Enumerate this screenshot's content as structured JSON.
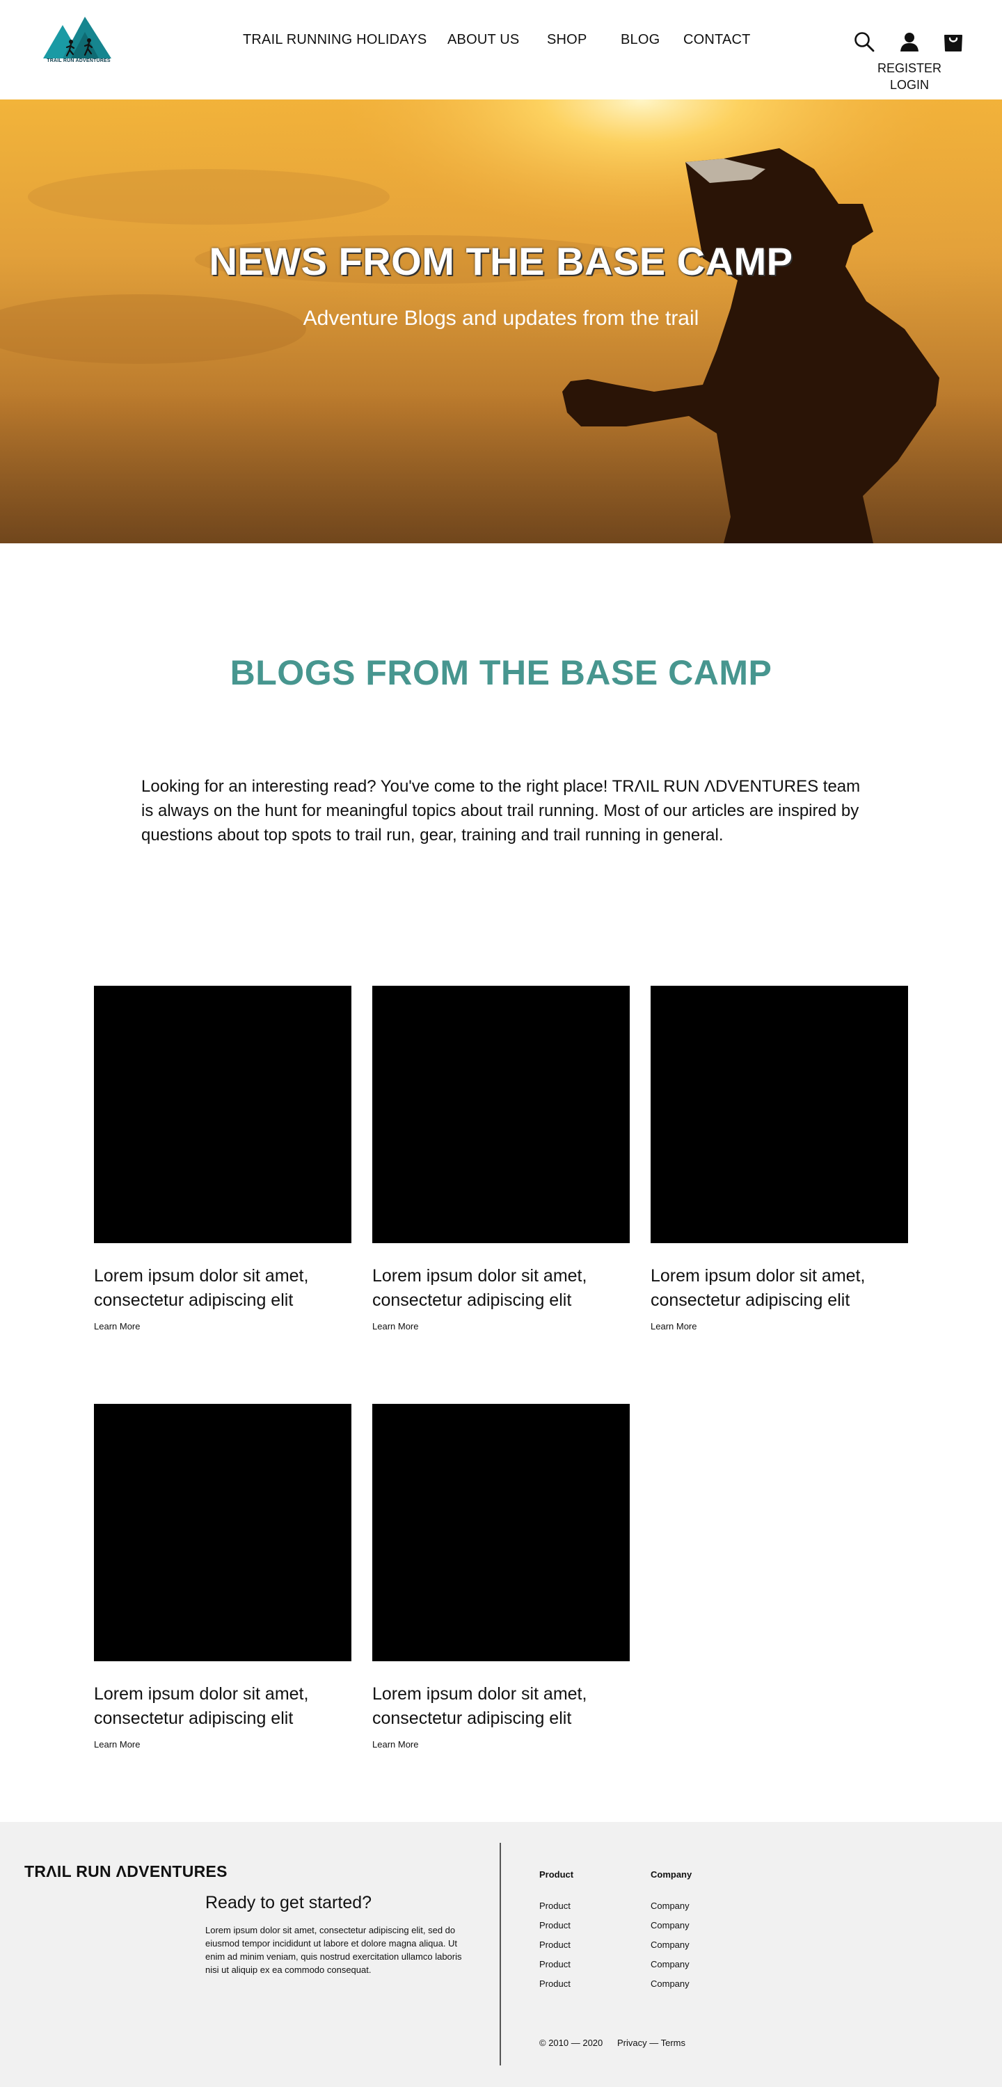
{
  "header": {
    "logo_text": "TRAIL RUN ADVENTURES",
    "nav": [
      {
        "label": "TRAIL RUNNING HOLIDAYS"
      },
      {
        "label": "ABOUT US"
      },
      {
        "label": "SHOP"
      },
      {
        "label": "BLOG"
      },
      {
        "label": "CONTACT"
      }
    ],
    "icons": [
      "search-icon",
      "user-icon",
      "shopping-bag-icon"
    ],
    "register_label": "REGISTER",
    "login_label": "LOGIN"
  },
  "hero": {
    "title": "NEWS FROM THE BASE CAMP",
    "subtitle": "Adventure Blogs and updates from the trail"
  },
  "section": {
    "title": "BLOGS FROM THE BASE CAMP",
    "intro": "Looking for an interesting read? You've come to the right place! TRΛIL RUN ΛDVENTURES team is always on the hunt for meaningful topics about trail running. Most of our articles are inspired by questions about top spots to trail run, gear, training and trail running in general."
  },
  "posts": [
    {
      "title": "Lorem ipsum dolor sit amet, consectetur adipiscing elit",
      "link": "Learn More"
    },
    {
      "title": "Lorem ipsum dolor sit amet, consectetur adipiscing elit",
      "link": "Learn More"
    },
    {
      "title": "Lorem ipsum dolor sit amet, consectetur adipiscing elit",
      "link": "Learn More"
    },
    {
      "title": "Lorem ipsum dolor sit amet, consectetur adipiscing elit",
      "link": "Learn More"
    },
    {
      "title": "Lorem ipsum dolor sit amet, consectetur adipiscing elit",
      "link": "Learn More"
    }
  ],
  "footer": {
    "brand": "TRΛIL RUN ΛDVENTURES",
    "cta_title": "Ready to get started?",
    "cta_body": "Lorem ipsum dolor sit amet, consectetur adipiscing elit, sed do eiusmod tempor incididunt ut labore et dolore magna aliqua. Ut enim ad minim veniam, quis nostrud exercitation ullamco laboris nisi ut aliquip ex ea commodo consequat.",
    "columns": [
      {
        "heading": "Product",
        "items": [
          "Product",
          "Product",
          "Product",
          "Product",
          "Product"
        ]
      },
      {
        "heading": "Company",
        "items": [
          "Company",
          "Company",
          "Company",
          "Company",
          "Company"
        ]
      }
    ],
    "copyright": "© 2010 — 2020",
    "legal": "Privacy — Terms"
  },
  "colors": {
    "accent": "#47968f",
    "logo_teal": "#1a9aa4",
    "footer_bg": "#f1f1f1"
  }
}
